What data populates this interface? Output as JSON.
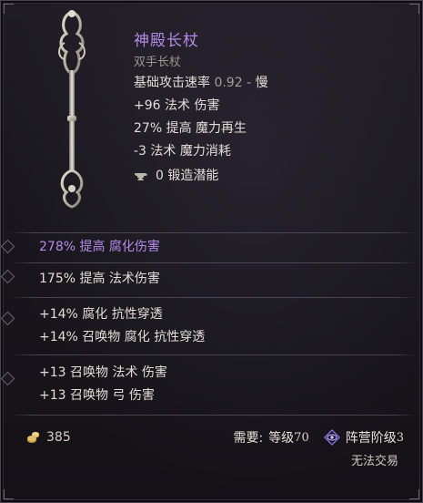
{
  "item": {
    "name": "神殿长杖",
    "type": "双手长杖",
    "stats": {
      "attack_speed_label": "基础攻击速率",
      "attack_speed_value": "0.92",
      "attack_speed_sep": "-",
      "attack_speed_desc": "慢",
      "line1": "+96 法术 伤害",
      "line2": "27% 提高 魔力再生",
      "line3": "-3 法术 魔力消耗",
      "forge_value": "0 锻造潜能"
    }
  },
  "affixes": {
    "group1": [
      "278% 提高 腐化伤害"
    ],
    "group2": [
      "175% 提高 法术伤害"
    ],
    "group3": [
      "+14% 腐化 抗性穿透",
      "+14% 召唤物 腐化 抗性穿透"
    ],
    "group4": [
      "+13 召唤物 法术 伤害",
      "+13 召唤物 弓 伤害"
    ]
  },
  "footer": {
    "gold": "385",
    "requirement_label": "需要:",
    "level_label": "等级",
    "level_value": "70",
    "faction_label": "阵营阶级",
    "faction_value": "3",
    "trade_status": "无法交易"
  },
  "colors": {
    "name": "#b58ae8",
    "special_affix": "#b58ae8",
    "text": "#e2ddd5",
    "muted": "#9b958c"
  },
  "icons": [
    "staff-icon",
    "anvil-icon",
    "gold-coins-icon",
    "faction-eye-icon"
  ]
}
